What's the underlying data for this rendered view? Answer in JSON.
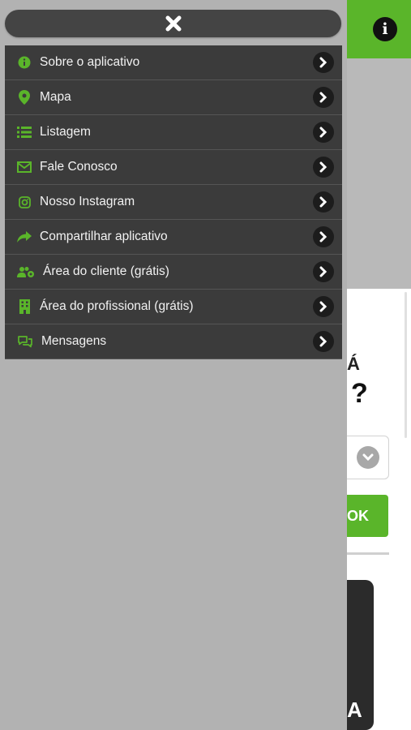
{
  "header": {
    "info_icon": "info-icon",
    "info_glyph": "i",
    "accent_color": "#5ab52a"
  },
  "background": {
    "partial_heading": "Á",
    "question_mark": "?",
    "ok_button_partial": "OK",
    "card_partial_text": "A"
  },
  "drawer": {
    "close_icon": "close-icon",
    "items": [
      {
        "label": "Sobre o aplicativo",
        "icon": "info-circle-icon"
      },
      {
        "label": "Mapa",
        "icon": "map-pin-icon"
      },
      {
        "label": "Listagem",
        "icon": "list-icon"
      },
      {
        "label": "Fale Conosco",
        "icon": "envelope-icon"
      },
      {
        "label": "Nosso Instagram",
        "icon": "instagram-icon"
      },
      {
        "label": "Compartilhar aplicativo",
        "icon": "share-icon"
      },
      {
        "label": "Área do cliente (grátis)",
        "icon": "users-cog-icon"
      },
      {
        "label": "Área do profissional (grátis)",
        "icon": "building-icon"
      },
      {
        "label": "Mensagens",
        "icon": "chat-icon"
      }
    ]
  }
}
